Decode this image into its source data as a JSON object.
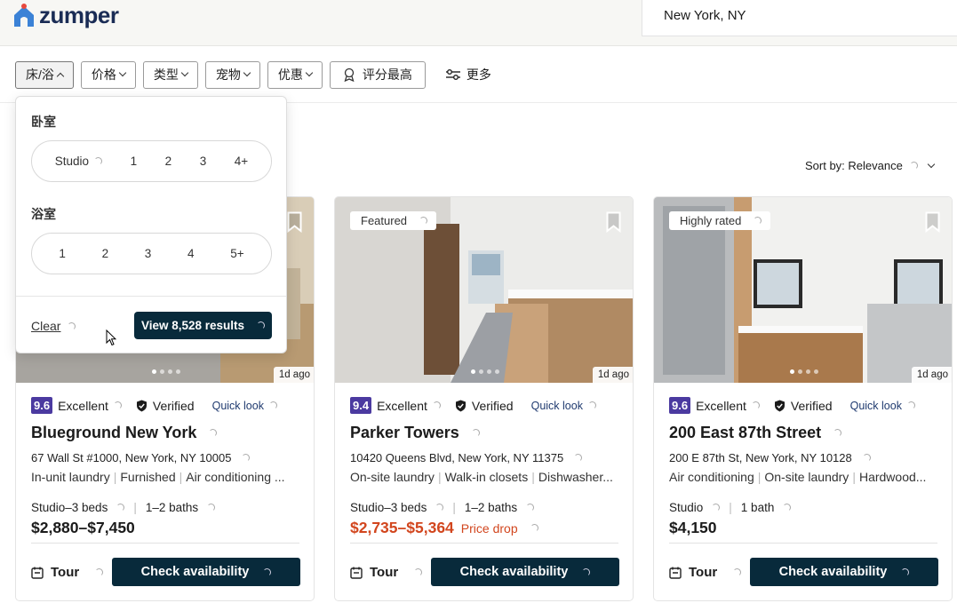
{
  "header": {
    "logo_text": "zumper",
    "location": "New York, NY"
  },
  "filters": [
    {
      "label": "床/浴",
      "name": "filter-bed-bath"
    },
    {
      "label": "价格",
      "name": "filter-price"
    },
    {
      "label": "类型",
      "name": "filter-type"
    },
    {
      "label": "宠物",
      "name": "filter-pets"
    },
    {
      "label": "优惠",
      "name": "filter-deals"
    }
  ],
  "filter_top_rated": "评分最高",
  "filter_more": "更多",
  "sort": {
    "label": "Sort by:",
    "value": "Relevance"
  },
  "dropdown": {
    "bedrooms_label": "卧室",
    "bedrooms": [
      "Studio",
      "1",
      "2",
      "3",
      "4+"
    ],
    "bathrooms_label": "浴室",
    "bathrooms": [
      "1",
      "2",
      "3",
      "4",
      "5+"
    ],
    "clear_label": "Clear",
    "view_label": "View 8,528 results"
  },
  "listings": [
    {
      "tag": "",
      "score": "9.6",
      "rating_text": "Excellent",
      "verified": "Verified",
      "quick_look": "Quick look",
      "name": "Blueground New York",
      "address": "67 Wall St #1000, New York, NY 10005",
      "amenities": [
        "In-unit laundry",
        "Furnished",
        "Air conditioning",
        "..."
      ],
      "beds": "Studio–3 beds",
      "baths": "1–2 baths",
      "price": "$2,880–$7,450",
      "price_note": "",
      "ago": "1d ago",
      "tour": "Tour",
      "cta": "Check availability"
    },
    {
      "tag": "Featured",
      "score": "9.4",
      "rating_text": "Excellent",
      "verified": "Verified",
      "quick_look": "Quick look",
      "name": "Parker Towers",
      "address": "10420 Queens Blvd, New York, NY 11375",
      "amenities": [
        "On-site laundry",
        "Walk-in closets",
        "Dishwasher..."
      ],
      "beds": "Studio–3 beds",
      "baths": "1–2 baths",
      "price": "$2,735–$5,364",
      "price_note": "Price drop",
      "ago": "1d ago",
      "tour": "Tour",
      "cta": "Check availability"
    },
    {
      "tag": "Highly rated",
      "score": "9.6",
      "rating_text": "Excellent",
      "verified": "Verified",
      "quick_look": "Quick look",
      "name": "200 East 87th Street",
      "address": "200 E 87th St, New York, NY 10128",
      "amenities": [
        "Air conditioning",
        "On-site laundry",
        "Hardwood..."
      ],
      "beds": "Studio",
      "baths": "1 bath",
      "price": "$4,150",
      "price_note": "",
      "ago": "1d ago",
      "tour": "Tour",
      "cta": "Check availability"
    }
  ],
  "colors": {
    "brand_navy": "#1a2c55",
    "logo_blue": "#3b82d6",
    "logo_pin": "#e8493d",
    "cta": "#082a3b",
    "score_badge": "#4b3aa0",
    "price_drop": "#d2461e"
  }
}
